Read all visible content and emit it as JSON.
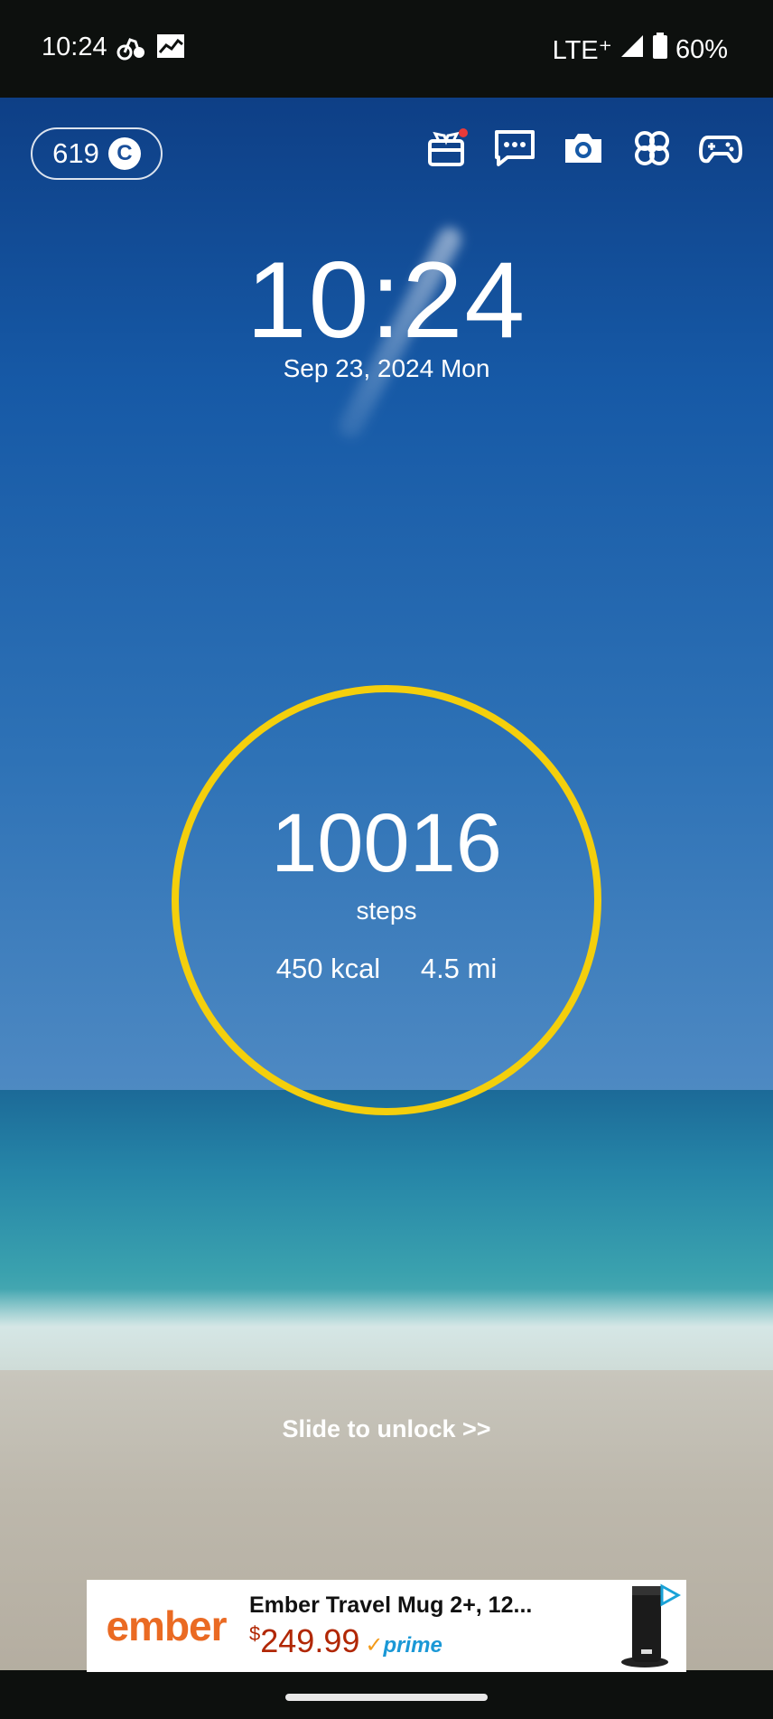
{
  "status_bar": {
    "time": "10:24",
    "network": "LTE⁺",
    "battery": "60%",
    "icons": [
      "notification-app-icon",
      "gallery-icon",
      "signal-icon",
      "battery-icon"
    ]
  },
  "coins": {
    "count": "619",
    "symbol": "C"
  },
  "top_icons": [
    "gift-box-icon",
    "chat-icon",
    "camera-icon",
    "clover-icon",
    "gamepad-icon"
  ],
  "clock": {
    "time": "10:24",
    "date": "Sep 23, 2024 Mon"
  },
  "pedometer": {
    "steps": "10016",
    "steps_label": "steps",
    "calories": "450 kcal",
    "distance": "4.5 mi",
    "ring_color": "#f4cf0c"
  },
  "unlock_text": "Slide to unlock >>",
  "ad": {
    "brand": "ember",
    "title": "Ember Travel Mug 2+, 12...",
    "currency": "$",
    "price": "249.99",
    "badge": "prime",
    "brand_color": "#ea6a23"
  }
}
